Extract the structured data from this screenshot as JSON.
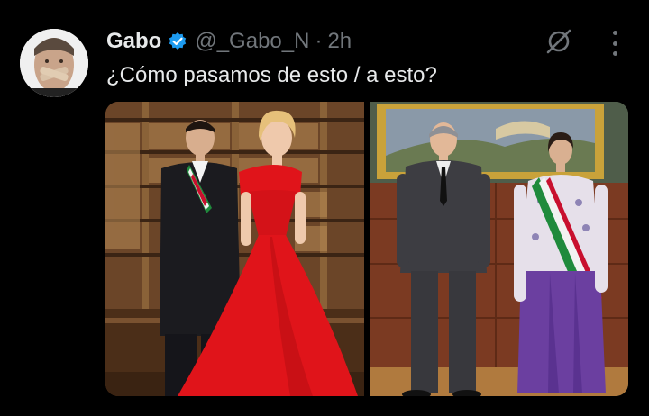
{
  "tweet": {
    "display_name": "Gabo",
    "handle": "@_Gabo_N",
    "separator": "·",
    "time": "2h",
    "text": "¿Cómo pasamos de esto / a esto?"
  },
  "icons": {
    "avatar": "avatar-image",
    "verified": "verified-badge-icon",
    "grok": "grok-icon",
    "more": "more-options-icon"
  },
  "colors": {
    "background": "#000000",
    "text": "#e7e9ea",
    "muted": "#71767b",
    "verified": "#1d9bf0",
    "red_dress": "#e0141a",
    "purple_skirt": "#6b3fa0"
  }
}
